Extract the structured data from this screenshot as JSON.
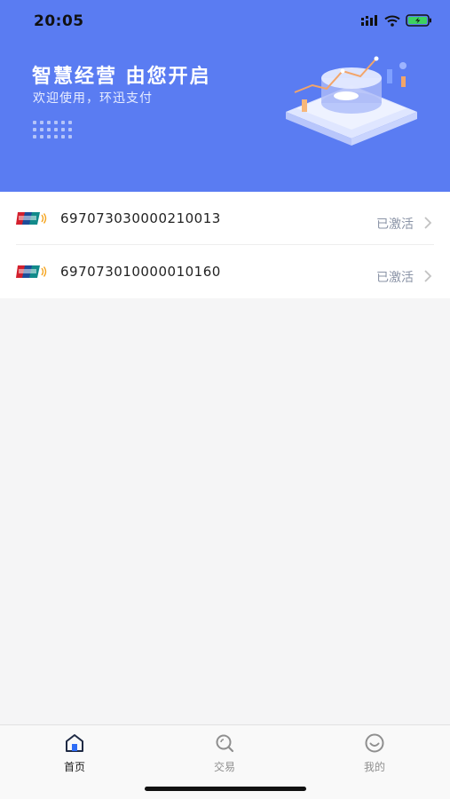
{
  "status_bar": {
    "time": "20:05"
  },
  "banner": {
    "title": "智慧经营  由您开启",
    "subtitle": "欢迎使用，环迅支付",
    "background_color": "#5a7cf2"
  },
  "cards": [
    {
      "icon": "unionpay-icon",
      "number": "697073030000210013",
      "status": "已激活"
    },
    {
      "icon": "unionpay-icon",
      "number": "697073010000010160",
      "status": "已激活"
    }
  ],
  "tab_bar": {
    "active_color": "#1a1a1a",
    "inactive_color": "#8f8f8f",
    "items": [
      {
        "label": "首页",
        "icon": "home-icon",
        "active": true
      },
      {
        "label": "交易",
        "icon": "search-icon",
        "active": false
      },
      {
        "label": "我的",
        "icon": "smile-icon",
        "active": false
      }
    ]
  }
}
